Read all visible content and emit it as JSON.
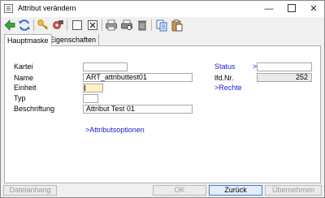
{
  "window": {
    "title": "Attribut verändern"
  },
  "toolbar": {
    "icons": [
      "arrow-left-icon",
      "refresh-icon",
      "key-icon",
      "settings-icon",
      "blank-page-icon",
      "delete-page-icon",
      "printer-icon",
      "print-preview-icon",
      "trash-icon",
      "copy-icon",
      "paste-icon"
    ]
  },
  "tabs": [
    {
      "label": "Hauptmaske"
    },
    {
      "label": "Eigenschaften"
    }
  ],
  "form": {
    "kartei": {
      "label": "Kartei",
      "value": ""
    },
    "name": {
      "label": "Name",
      "value": "ART_attributtest01"
    },
    "einheit": {
      "label": "Einheit",
      "value": ""
    },
    "typ": {
      "label": "Typ",
      "value": ""
    },
    "beschriftung": {
      "label": "Beschriftung",
      "value": "Attribut Test 01"
    },
    "status": {
      "label": "Status",
      "link": ">",
      "value": ""
    },
    "lfd_nr": {
      "label": "lfd.Nr.",
      "value": "252"
    },
    "rechte_link": ">Rechte",
    "attributsoptionen_link": ">Attributsoptionen"
  },
  "footer": {
    "dateianhang": "Dateianhang",
    "ok": "OK",
    "zurueck": "Zurück",
    "uebernehmen": "Übernehmen"
  }
}
